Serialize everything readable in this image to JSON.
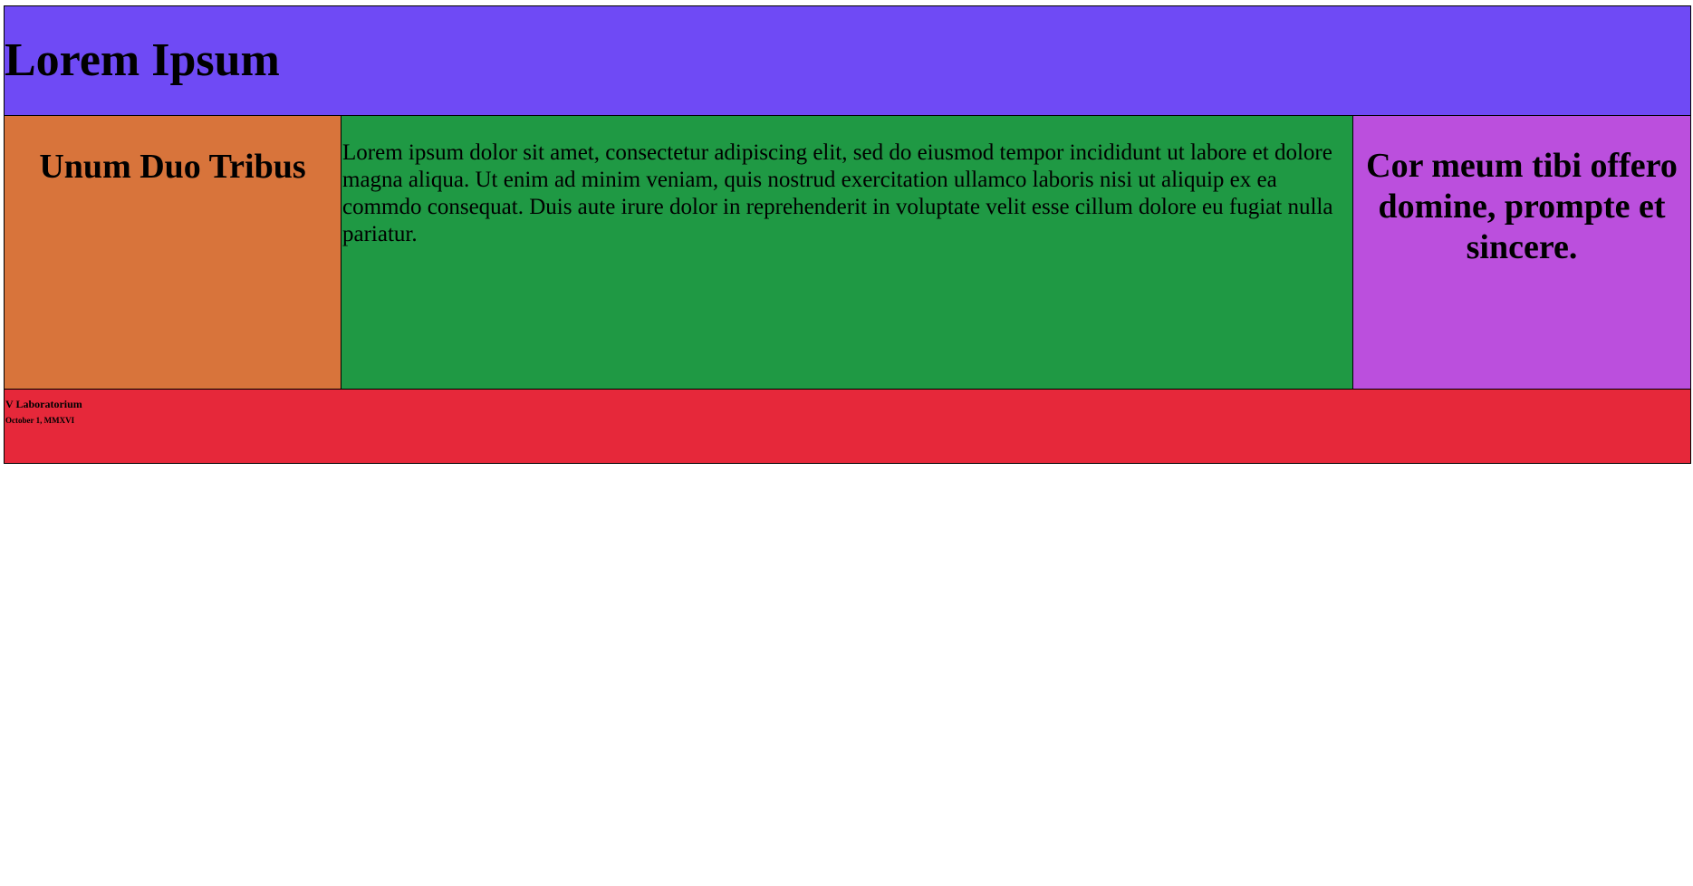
{
  "header": {
    "title": "Lorem Ipsum"
  },
  "left": {
    "heading": "Unum Duo Tribus"
  },
  "center": {
    "text": "Lorem ipsum dolor sit amet, consectetur adipiscing elit, sed do eiusmod tempor incididunt ut labore et dolore magna aliqua. Ut enim ad minim veniam, quis nostrud exercitation ullamco laboris nisi ut aliquip ex ea commdo consequat. Duis aute irure dolor in reprehenderit in voluptate velit esse cillum dolore eu fugiat nulla pariatur."
  },
  "right": {
    "heading": "Cor meum tibi offero domine, prompte et sincere."
  },
  "footer": {
    "name": "V Laboratorium",
    "date": "October 1, MMXVI"
  },
  "colors": {
    "header_bg": "#6f4af5",
    "left_bg": "#d8743b",
    "center_bg": "#1f9944",
    "right_bg": "#bb4fdd",
    "footer_bg": "#e6283a"
  }
}
